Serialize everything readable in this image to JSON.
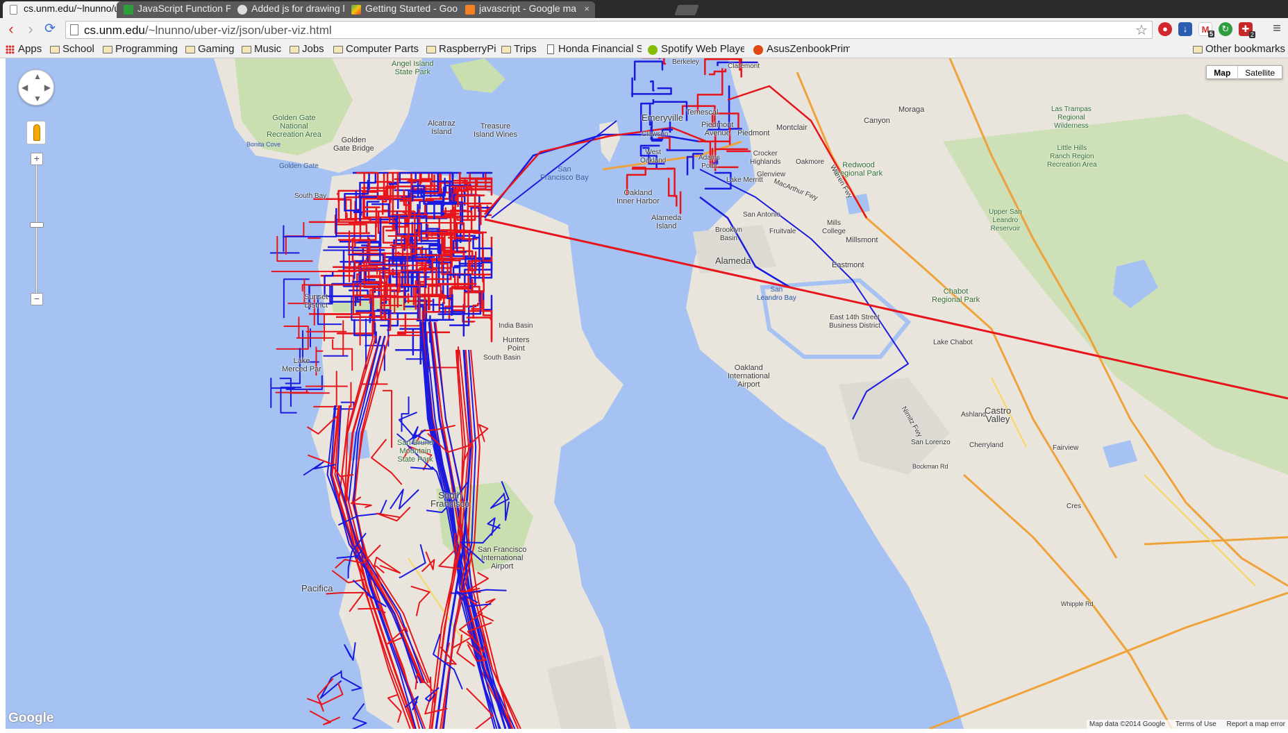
{
  "tabs": [
    {
      "title": "cs.unm.edu/~lnunno/u",
      "active": true
    },
    {
      "title": "JavaScript Function P",
      "active": false
    },
    {
      "title": "Added js for drawing l",
      "active": false
    },
    {
      "title": "Getting Started - Goo",
      "active": false
    },
    {
      "title": "javascript - Google ma",
      "active": false
    }
  ],
  "tab_close_glyph": "×",
  "toolbar": {
    "url_host": "cs.unm.edu",
    "url_path": "/~lnunno/uber-viz/json/uber-viz.html",
    "ext_badges": [
      "5",
      "2"
    ]
  },
  "bookmarks": [
    {
      "label": "Apps",
      "icon": "apps-grid-icon"
    },
    {
      "label": "School",
      "icon": "folder-icon"
    },
    {
      "label": "Programming",
      "icon": "folder-icon"
    },
    {
      "label": "Gaming",
      "icon": "folder-icon"
    },
    {
      "label": "Music",
      "icon": "folder-icon"
    },
    {
      "label": "Jobs",
      "icon": "folder-icon"
    },
    {
      "label": "Computer Parts",
      "icon": "folder-icon"
    },
    {
      "label": "RaspberryPi",
      "icon": "folder-icon"
    },
    {
      "label": "Trips",
      "icon": "folder-icon"
    },
    {
      "label": "Honda Financial Se",
      "icon": "page-icon"
    },
    {
      "label": "Spotify Web Player",
      "icon": "spotify-icon"
    },
    {
      "label": "AsusZenbookPrime",
      "icon": "ubuntu-icon"
    }
  ],
  "other_bookmarks": "Other bookmarks",
  "map": {
    "map_type_options": [
      "Map",
      "Satellite"
    ],
    "selected_map_type": "Map",
    "zoom_in": "+",
    "zoom_out": "−",
    "logo": "Google",
    "attribution": [
      "Map data ©2014 Google",
      "Terms of Use",
      "Report a map error"
    ],
    "trip_colors": {
      "red": "#e8141b",
      "blue": "#1a1ae0"
    },
    "labels": {
      "angel_island": "Angel Island\nState Park",
      "golden_gate_nra": "Golden Gate\nNational\nRecreation Area",
      "bonita_cove": "Bonita Cove",
      "golden_gate_bridge": "Golden\nGate Bridge",
      "golden_gate": "Golden Gate",
      "alcatraz": "Alcatraz\nIsland",
      "treasure_island": "Treasure\nIsland Wines",
      "sf_bay": "San\nFrancisco Bay",
      "south_bay": "South Bay",
      "sunset_district": "Sunset\nDistrict",
      "india_basin": "India Basin",
      "hunters_point": "Hunters\nPoint",
      "south_basin": "South Basin",
      "lake_merced": "Lake\nMerced Par",
      "san_bruno": "San Bruno\nMountain\nState Park",
      "south_sf": "South\nFrancisco",
      "sfo": "San Francisco\nInternational\nAirport",
      "pacifica": "Pacifica",
      "oakland_inner_harbor": "Oakland\nInner Harbor",
      "alameda_island": "Alameda\nIsland",
      "alameda": "Alameda",
      "oakland_airport": "Oakland\nInternational\nAirport",
      "emeryville": "Emeryville",
      "piedmont": "Piedmont",
      "piedmont_avenue": "Piedmont\nAvenue",
      "temescal": "Temescal",
      "montclair": "Montclair",
      "moraga": "Moraga",
      "canyon": "Canyon",
      "redwood_park": "Redwood\nRegional Park",
      "las_trampas": "Las Trampas\nRegional\nWilderness",
      "little_hills": "Little Hills\nRanch Region\nRecreation Area",
      "upper_san_leandro": "Upper San\nLeandro\nReservoir",
      "chabot_park": "Chabot\nRegional Park",
      "lake_chabot": "Lake Chabot",
      "san_leandro_bay": "San\nLeandro Bay",
      "east_14th": "East 14th Street\nBusiness District",
      "eastmont": "Eastmont",
      "millsmont": "Millsmont",
      "mills_college": "Mills\nCollege",
      "fruitvale": "Fruitvale",
      "san_antonio": "San Antonio",
      "brooklyn_basin": "Brooklyn\nBasin",
      "crocker_highlands": "Crocker\nHighlands",
      "oakmore": "Oakmore",
      "lake_merritt": "Lake Merritt",
      "adams_point": "Adams\nPoint",
      "west_oakland": "West\nOakland",
      "clawson": "Clawson",
      "glenview": "Glenview",
      "claremont": "Claremont",
      "berkeley": "Berkeley",
      "castro_valley": "Castro\nValley",
      "ashland": "Ashland",
      "san_lorenzo": "San Lorenzo",
      "cherryland": "Cherryland",
      "fairview": "Fairview",
      "bockman_rd": "Bockman Rd",
      "macarthur_fwy": "MacArthur Fwy",
      "warren_fwy": "Warren Fwy",
      "nimitz_fwy": "Nimitz Fwy",
      "whipple_rd": "Whipple Rd",
      "crest": "Cres"
    }
  }
}
